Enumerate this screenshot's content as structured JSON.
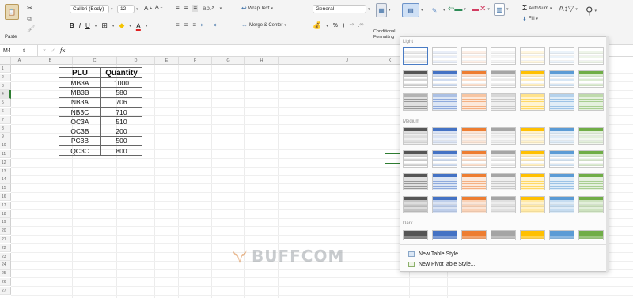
{
  "ribbon": {
    "paste_label": "Paste",
    "font_name": "Calibri (Body)",
    "font_size": "12",
    "bold": "B",
    "italic": "I",
    "underline": "U",
    "grow_font": "A",
    "shrink_font": "A",
    "wrap_text": "Wrap Text",
    "merge_center": "Merge & Center",
    "number_format": "General",
    "percent": "%",
    "comma": ")",
    "conditional_formatting": "Conditional\nFormatting",
    "autosum": "AutoSum",
    "fill": "Fill"
  },
  "formula_bar": {
    "name_box": "M4",
    "cancel": "×",
    "enter": "✓",
    "fx": "fx"
  },
  "columns": [
    "A",
    "B",
    "C",
    "D",
    "E",
    "F",
    "G",
    "H",
    "I",
    "J",
    "K",
    "L",
    "M"
  ],
  "rows": [
    "1",
    "2",
    "3",
    "4",
    "5",
    "6",
    "7",
    "8",
    "9",
    "10",
    "11",
    "12",
    "13",
    "14",
    "15",
    "16",
    "17",
    "18",
    "19",
    "20",
    "21",
    "22",
    "23",
    "24",
    "25",
    "26",
    "27"
  ],
  "table": {
    "headers": [
      "PLU",
      "Quantity"
    ],
    "rows": [
      [
        "MB3A",
        "1000"
      ],
      [
        "MB3B",
        "580"
      ],
      [
        "NB3A",
        "706"
      ],
      [
        "NB3C",
        "710"
      ],
      [
        "OC3A",
        "510"
      ],
      [
        "OC3B",
        "200"
      ],
      [
        "PC3B",
        "500"
      ],
      [
        "QC3C",
        "800"
      ]
    ]
  },
  "watermark": "BUFFCOM",
  "gallery": {
    "sections": {
      "light": "Light",
      "medium": "Medium",
      "dark": "Dark"
    },
    "new_table_style": "New Table Style...",
    "new_pivot_style": "New PivotTable Style...",
    "palette": [
      "#555555",
      "#4472c4",
      "#ed7d31",
      "#a5a5a5",
      "#ffc000",
      "#5b9bd5",
      "#70ad47"
    ]
  }
}
